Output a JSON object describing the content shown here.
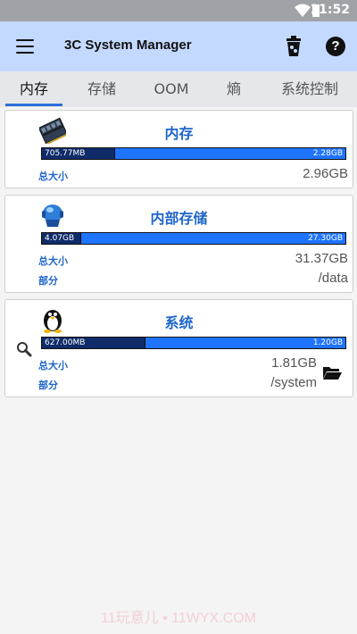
{
  "status_bar": {
    "time": "11:52"
  },
  "app_bar": {
    "title": "3C System Manager",
    "help_glyph": "?"
  },
  "tabs": [
    {
      "label": "内存"
    },
    {
      "label": "存储"
    },
    {
      "label": "OOM"
    },
    {
      "label": "熵"
    },
    {
      "label": "系统控制"
    }
  ],
  "cards": {
    "memory": {
      "title": "内存",
      "used": "705.77MB",
      "free": "2.28GB",
      "used_fraction": 0.24,
      "total_label": "总大小",
      "total_value": "2.96GB"
    },
    "internal": {
      "title": "内部存储",
      "used": "4.07GB",
      "free": "27.30GB",
      "used_fraction": 0.13,
      "total_label": "总大小",
      "total_value": "31.37GB",
      "partition_label": "部分",
      "partition_value": "/data"
    },
    "system": {
      "title": "系统",
      "used": "627.00MB",
      "free": "1.20GB",
      "used_fraction": 0.34,
      "total_label": "总大小",
      "total_value": "1.81GB",
      "partition_label": "部分",
      "partition_value": "/system"
    }
  },
  "watermark": "11玩意儿 • 11WYX.COM"
}
